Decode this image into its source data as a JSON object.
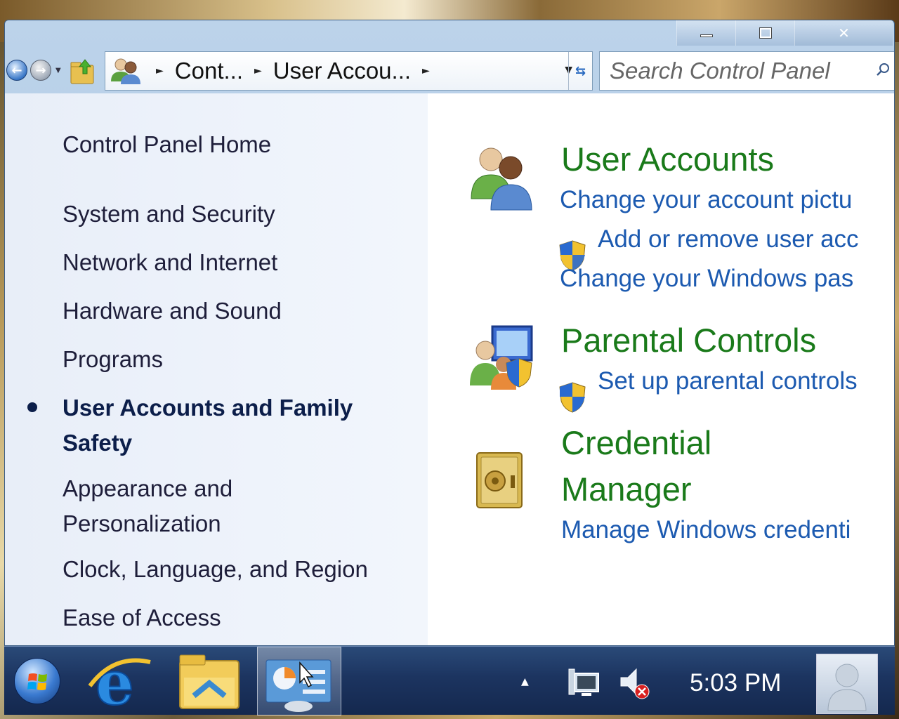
{
  "window": {
    "caption": {
      "minimize_icon": "minimize-icon",
      "maximize_icon": "restore-icon",
      "close_label": "✕"
    }
  },
  "toolbar": {
    "back_icon": "back-arrow-icon",
    "forward_icon": "forward-arrow-icon",
    "breadcrumbs": [
      "Cont...",
      "User Accou..."
    ],
    "search": {
      "placeholder": "Search Control Panel"
    }
  },
  "left_nav": {
    "items": [
      {
        "label": "Control Panel Home"
      },
      {
        "label": "System and Security"
      },
      {
        "label": "Network and Internet"
      },
      {
        "label": "Hardware and Sound"
      },
      {
        "label": "Programs"
      },
      {
        "label_line1": "User Accounts and Family",
        "label_line2": "Safety",
        "active": true
      },
      {
        "label_line1": "Appearance and",
        "label_line2": "Personalization"
      },
      {
        "label": "Clock, Language, and Region"
      },
      {
        "label": "Ease of Access"
      }
    ]
  },
  "categories": [
    {
      "title": "User Accounts",
      "links": [
        "Change your account pictu",
        "Add or remove user acc",
        "Change your Windows pas"
      ]
    },
    {
      "title": "Parental Controls",
      "links": [
        "Set up parental controls"
      ]
    },
    {
      "title_line1": "Credential",
      "title_line2": "Manager",
      "links": [
        "Manage Windows credenti"
      ]
    }
  ],
  "taskbar": {
    "clock": "5:03 PM",
    "tray_arrow": "▲"
  },
  "colors": {
    "category_title": "#1a7a1a",
    "link": "#1c5ab0",
    "taskbar": "#1c3460"
  }
}
